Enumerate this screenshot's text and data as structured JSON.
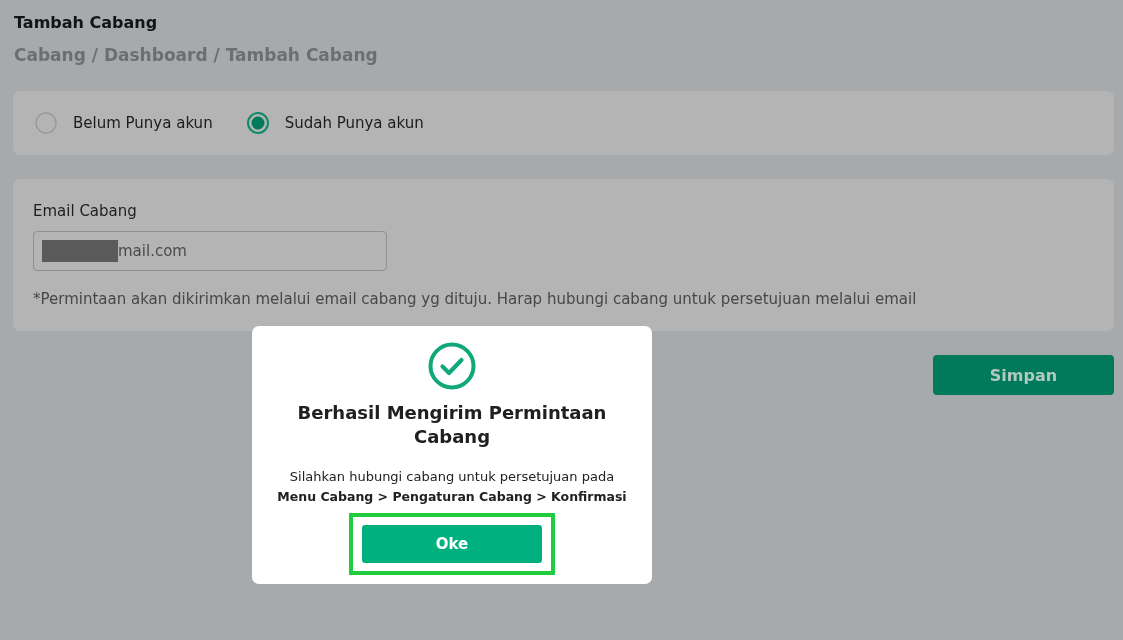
{
  "page": {
    "title": "Tambah Cabang",
    "breadcrumb": "Cabang / Dashboard / Tambah Cabang"
  },
  "account_options": [
    {
      "label": "Belum Punya akun",
      "selected": false
    },
    {
      "label": "Sudah Punya akun",
      "selected": true
    }
  ],
  "email_section": {
    "label": "Email Cabang",
    "value": "mail.com",
    "redacted": true,
    "note": "*Permintaan akan dikirimkan melalui email cabang yg dituju. Harap hubungi cabang untuk persetujuan melalui email"
  },
  "save_button": "Simpan",
  "dialog": {
    "title": "Berhasil Mengirim Permintaan Cabang",
    "message": "Silahkan hubungi cabang untuk persetujuan pada **Menu Cabang > Pengaturan Cabang > Konfirmasi**",
    "button": {
      "label": "Oke",
      "highlighted": true
    }
  }
}
